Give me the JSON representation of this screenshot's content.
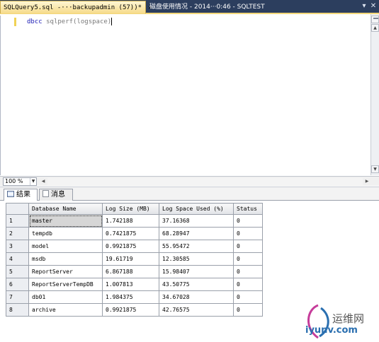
{
  "tabs": {
    "active_title": "SQLQuery5.sql -···backupadmin (57))*",
    "active_close": "✕",
    "inactive_title": "磁盘使用情况 - 2014···0:46 - SQLTEST"
  },
  "editor": {
    "keyword": "dbcc",
    "command": "sqlperf(logspace)"
  },
  "zoom": {
    "value": "100 %"
  },
  "results_tabs": [
    {
      "label": "结果",
      "icon": "grid-icon"
    },
    {
      "label": "消息",
      "icon": "message-icon"
    }
  ],
  "grid": {
    "columns": [
      "Database Name",
      "Log Size (MB)",
      "Log Space Used (%)",
      "Status"
    ],
    "rows": [
      {
        "num": "1",
        "name": "master",
        "size": "1.742188",
        "used": "37.16368",
        "status": "0"
      },
      {
        "num": "2",
        "name": "tempdb",
        "size": "0.7421875",
        "used": "68.28947",
        "status": "0"
      },
      {
        "num": "3",
        "name": "model",
        "size": "0.9921875",
        "used": "55.95472",
        "status": "0"
      },
      {
        "num": "4",
        "name": "msdb",
        "size": "19.61719",
        "used": "12.30585",
        "status": "0"
      },
      {
        "num": "5",
        "name": "ReportServer",
        "size": "6.867188",
        "used": "15.98407",
        "status": "0"
      },
      {
        "num": "6",
        "name": "ReportServerTempDB",
        "size": "1.007813",
        "used": "43.50775",
        "status": "0"
      },
      {
        "num": "7",
        "name": "db01",
        "size": "1.984375",
        "used": "34.67028",
        "status": "0"
      },
      {
        "num": "8",
        "name": "archive",
        "size": "0.9921875",
        "used": "42.76575",
        "status": "0"
      }
    ]
  },
  "watermark": {
    "cn": "运维网",
    "en": "iyunv.com"
  },
  "colors": {
    "tab_strip": "#2c3e5e",
    "active_tab": "#f6db8a",
    "keyword": "#1a1ab4"
  }
}
